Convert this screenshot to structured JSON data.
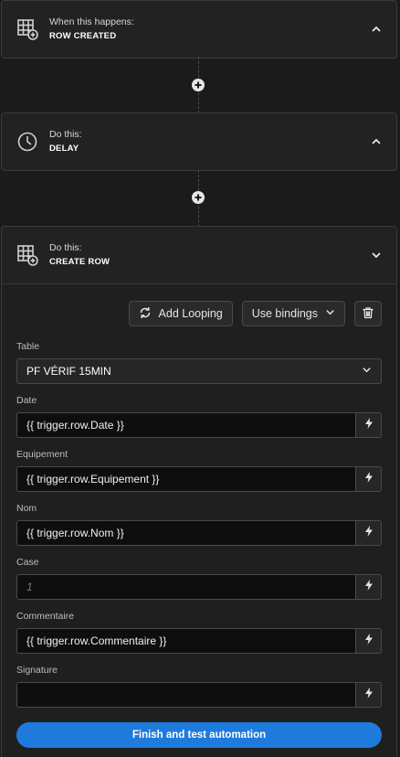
{
  "steps": [
    {
      "eyebrow": "When this happens:",
      "title": "ROW CREATED",
      "icon": "table-add-icon",
      "expanded": false
    },
    {
      "eyebrow": "Do this:",
      "title": "DELAY",
      "icon": "clock-icon",
      "expanded": false
    },
    {
      "eyebrow": "Do this:",
      "title": "CREATE ROW",
      "icon": "table-add-icon",
      "expanded": true
    }
  ],
  "toolbar": {
    "add_looping": "Add Looping",
    "use_bindings": "Use bindings"
  },
  "table": {
    "label": "Table",
    "value": "PF VÉRIF 15MIN"
  },
  "fields": [
    {
      "label": "Date",
      "value": "{{ trigger.row.Date }}"
    },
    {
      "label": "Equipement",
      "value": "{{ trigger.row.Equipement }}"
    },
    {
      "label": "Nom",
      "value": "{{ trigger.row.Nom }}"
    },
    {
      "label": "Case",
      "placeholder": "1"
    },
    {
      "label": "Commentaire",
      "value": "{{ trigger.row.Commentaire }}"
    },
    {
      "label": "Signature",
      "value": ""
    }
  ],
  "finish_button": "Finish and test automation",
  "colors": {
    "accent": "#1e7bdc",
    "background": "#1b1b1b",
    "card": "#222222"
  }
}
